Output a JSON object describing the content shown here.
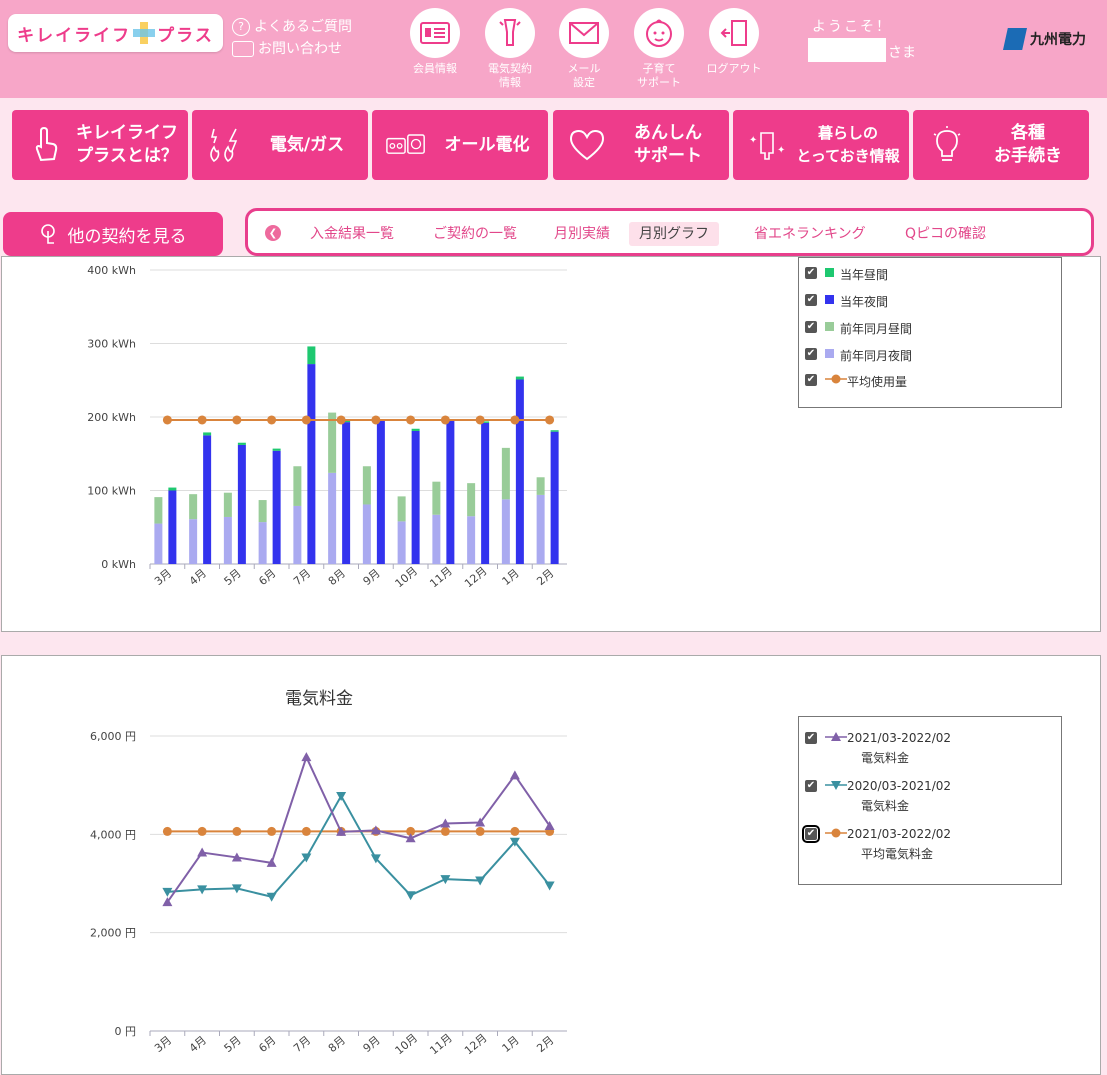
{
  "header": {
    "logo_text_left": "キレイライフ",
    "logo_text_right": "プラス",
    "faq": "よくあるご質問",
    "contact": "お問い合わせ",
    "buttons": [
      {
        "label": "会員情報",
        "icon": "member-card-icon"
      },
      {
        "label": "電気契約\n情報",
        "icon": "flashlight-icon"
      },
      {
        "label": "メール\n設定",
        "icon": "envelope-icon"
      },
      {
        "label": "子育て\nサポート",
        "icon": "baby-face-icon"
      },
      {
        "label": "ログアウト",
        "icon": "logout-door-icon"
      }
    ],
    "welcome": "ようこそ！",
    "user_suffix": "さま",
    "company": "九州電力"
  },
  "menu": [
    {
      "label": "キレイライフ\nプラスとは？",
      "icon": "finger-point-icon"
    },
    {
      "label": "電気/ガス",
      "icon": "flame-bolt-icon"
    },
    {
      "label": "オール電化",
      "icon": "appliance-icon"
    },
    {
      "label": "あんしん\nサポート",
      "icon": "heart-icon"
    },
    {
      "label": "暮らしの\nとっておき情報",
      "icon": "sparkle-icon"
    },
    {
      "label": "各種\nお手続き",
      "icon": "lightbulb-icon"
    }
  ],
  "other_contracts": "他の契約を見る",
  "tabs": [
    "入金結果一覧",
    "ご契約の一覧",
    "月別実績",
    "月別グラフ",
    "省エネランキング",
    "Qピコの確認"
  ],
  "active_tab": "月別グラフ",
  "colors": {
    "brand_pink": "#ee3c8b",
    "header_pink": "#f7a6c8",
    "day_current": "#1ec870",
    "night_current": "#3333ee",
    "day_prev": "#99cc99",
    "night_prev": "#aaaaf0",
    "average": "#d9843c",
    "bill_current": "#8060a8",
    "bill_prev": "#3a90a0"
  },
  "chart_data": [
    {
      "type": "bar",
      "categories": [
        "3月",
        "4月",
        "5月",
        "6月",
        "7月",
        "8月",
        "9月",
        "10月",
        "11月",
        "12月",
        "1月",
        "2月"
      ],
      "series": [
        {
          "name": "当年昼間",
          "values": [
            4,
            4,
            3,
            3,
            24,
            2,
            2,
            3,
            2,
            2,
            4,
            2
          ]
        },
        {
          "name": "当年夜間",
          "values": [
            100,
            175,
            162,
            154,
            272,
            193,
            195,
            181,
            195,
            192,
            251,
            180
          ]
        },
        {
          "name": "前年同月昼間",
          "values": [
            36,
            34,
            33,
            30,
            54,
            82,
            52,
            34,
            45,
            45,
            70,
            24
          ]
        },
        {
          "name": "前年同月夜間",
          "values": [
            55,
            61,
            64,
            57,
            79,
            124,
            81,
            58,
            67,
            65,
            88,
            94
          ]
        },
        {
          "name": "平均使用量",
          "values": [
            196,
            196,
            196,
            196,
            196,
            196,
            196,
            196,
            196,
            196,
            196,
            196
          ]
        }
      ],
      "yticks": [
        "0 kWh",
        "100 kWh",
        "200 kWh",
        "300 kWh",
        "400 kWh"
      ],
      "ylim": [
        0,
        400
      ],
      "legend": [
        {
          "label": "当年昼間",
          "kind": "square"
        },
        {
          "label": "当年夜間",
          "kind": "square"
        },
        {
          "label": "前年同月昼間",
          "kind": "square"
        },
        {
          "label": "前年同月夜間",
          "kind": "square"
        },
        {
          "label": "平均使用量",
          "kind": "circle-line"
        }
      ],
      "legend_placement": "right"
    },
    {
      "type": "line",
      "title": "電気料金",
      "categories": [
        "3月",
        "4月",
        "5月",
        "6月",
        "7月",
        "8月",
        "9月",
        "10月",
        "11月",
        "12月",
        "1月",
        "2月"
      ],
      "series": [
        {
          "name": "2021/03-2022/02 電気料金",
          "values": [
            2620,
            3630,
            3530,
            3420,
            5570,
            4050,
            4080,
            3920,
            4220,
            4240,
            5200,
            4170
          ]
        },
        {
          "name": "2020/03-2021/02 電気料金",
          "values": [
            2830,
            2880,
            2900,
            2730,
            3530,
            4780,
            3510,
            2760,
            3090,
            3060,
            3850,
            2960
          ]
        },
        {
          "name": "2021/03-2022/02 平均電気料金",
          "values": [
            4060,
            4060,
            4060,
            4060,
            4060,
            4060,
            4060,
            4060,
            4060,
            4060,
            4060,
            4060
          ]
        }
      ],
      "yticks": [
        "0 円",
        "2,000 円",
        "4,000 円",
        "6,000 円"
      ],
      "ylim": [
        0,
        6000
      ],
      "legend": [
        {
          "line1": "2021/03-2022/02",
          "line2": "電気料金",
          "kind": "triangle-up"
        },
        {
          "line1": "2020/03-2021/02",
          "line2": "電気料金",
          "kind": "triangle-down"
        },
        {
          "line1": "2021/03-2022/02",
          "line2": "平均電気料金",
          "kind": "circle"
        }
      ],
      "legend_placement": "right"
    }
  ]
}
